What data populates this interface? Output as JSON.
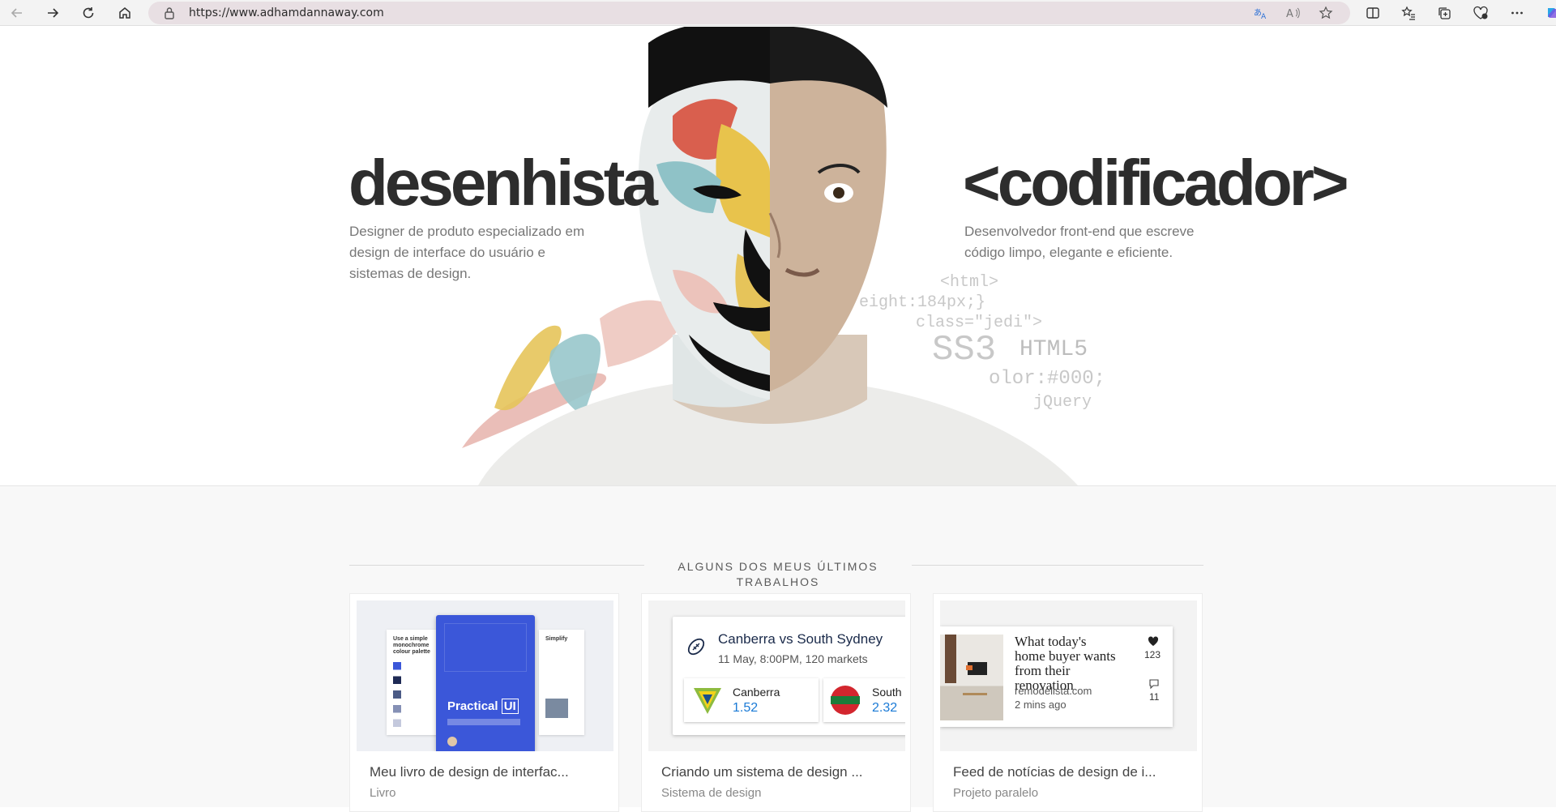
{
  "browser": {
    "url": "https://www.adhamdannaway.com"
  },
  "hero": {
    "left_title": "desenhista",
    "left_text": "Designer de produto especializado em design de interface do usuário e sistemas de design.",
    "right_title": "<codificador>",
    "right_text": "Desenvolvedor front-end que escreve código limpo, elegante e eficiente.",
    "code_lines": [
      "<html>",
      "eight:184px;}",
      "class=\"jedi\">",
      "SS3",
      "HTML5",
      "olor:#000;",
      "jQuery"
    ]
  },
  "works": {
    "section_title": "ALGUNS DOS MEUS ÚLTIMOS TRABALHOS",
    "cards": [
      {
        "title": "Meu livro de design de interfac...",
        "subtitle": "Livro",
        "book_title": "Practical",
        "book_title_boxed": "UI",
        "page_left_heading": "Use a simple monochrome colour palette",
        "page_right_heading": "Simplify"
      },
      {
        "title": "Criando um sistema de design ...",
        "subtitle": "Sistema de design",
        "match_title": "Canberra vs South Sydney",
        "match_sub": "11 May, 8:00PM, 120 markets",
        "team1": "Canberra",
        "odds1": "1.52",
        "team2": "South",
        "odds2": "2.32"
      },
      {
        "title": "Feed de notícias de design de i...",
        "subtitle": "Projeto paralelo",
        "feed_title": "What today's home buyer wants from their renovation",
        "feed_source": "remodelista.com",
        "feed_age": "2 mins ago",
        "likes": "123",
        "comments": "11"
      }
    ]
  },
  "colors": {
    "title": "#2d2d2d",
    "book_blue": "#3b57d9",
    "odds_blue": "#1a7ad6"
  }
}
